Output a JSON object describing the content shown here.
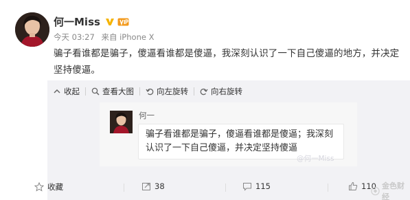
{
  "post": {
    "author_name": "何一Miss",
    "time": "今天 03:27",
    "source": "来自 iPhone X",
    "text": "骗子看谁都是骗子，傻逼看谁都是傻逼，我深刻认识了一下自己傻逼的地方，并决定坚持傻逼。"
  },
  "media_tools": {
    "collapse": "收起",
    "view_large": "查看大图",
    "rotate_left": "向左旋转",
    "rotate_right": "向右旋转"
  },
  "embedded_card": {
    "name": "何一",
    "message": "骗子看谁都是骗子，傻逼看谁都是傻逼；我深刻认识了一下自己傻逼，并决定坚持傻逼"
  },
  "watermark": "@何一Miss",
  "actions": {
    "favorite": "收藏",
    "repost_count": "38",
    "comment_count": "115",
    "like_count": "110"
  },
  "brand": "金色财经",
  "colors": {
    "verified_gold": "#f5b400",
    "vip_orange": "#f39a1c",
    "media_bg": "#f2f2f5"
  }
}
